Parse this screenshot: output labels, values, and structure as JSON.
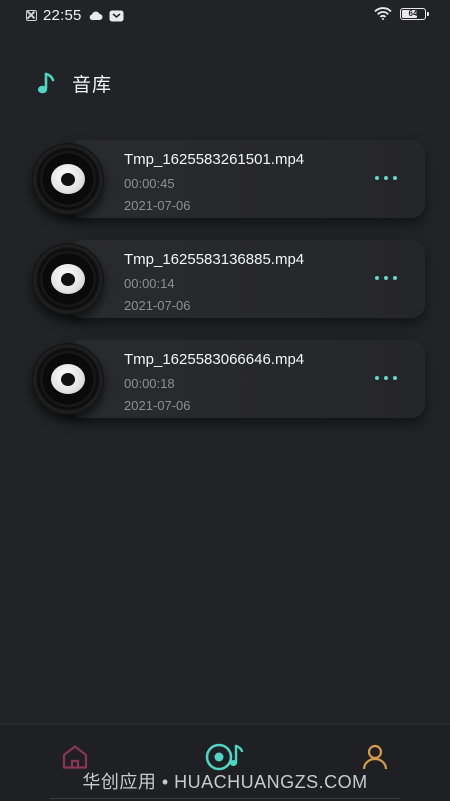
{
  "status_bar": {
    "time": "22:55",
    "battery": "64",
    "icons": [
      "close-notification-icon",
      "cloud-icon",
      "message-icon",
      "wifi-icon",
      "battery-icon"
    ]
  },
  "header": {
    "title": "音库",
    "icon": "music-note-icon",
    "accent_color": "#4fd6c3"
  },
  "tracks": [
    {
      "name": "Tmp_1625583261501.mp4",
      "duration": "00:00:45",
      "date": "2021-07-06"
    },
    {
      "name": "Tmp_1625583136885.mp4",
      "duration": "00:00:14",
      "date": "2021-07-06"
    },
    {
      "name": "Tmp_1625583066646.mp4",
      "duration": "00:00:18",
      "date": "2021-07-06"
    }
  ],
  "bottom_nav": {
    "items": [
      {
        "id": "home",
        "icon": "home-icon",
        "color": "#8a3553",
        "active": false
      },
      {
        "id": "library",
        "icon": "vinyl-music-icon",
        "color": "#4fd6c3",
        "active": true
      },
      {
        "id": "profile",
        "icon": "user-icon",
        "color": "#d69a4a",
        "active": false
      }
    ],
    "watermark": "华创应用 • HUACHUANGZS.COM"
  },
  "colors": {
    "background": "#222326",
    "card": "#2a2b2f",
    "secondary_text": "#8e8f93",
    "accent": "#5fd9c9"
  }
}
